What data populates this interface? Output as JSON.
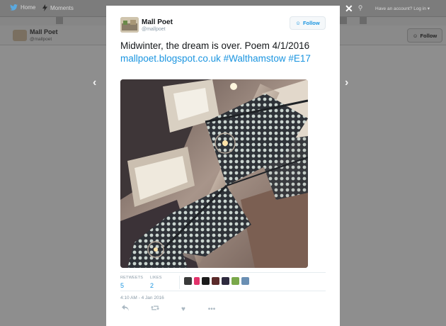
{
  "background": {
    "nav": {
      "home": "Home",
      "moments": "Moments",
      "account": "Have an account? Log in"
    },
    "profile": {
      "name": "Mall Poet",
      "handle": "@mallpoet",
      "follow_label": "Follow"
    }
  },
  "modal": {
    "author": {
      "name": "Mall Poet",
      "handle": "@mallpoet"
    },
    "follow_label": "Follow",
    "tweet": {
      "text": "Midwinter, the dream is over. Poem 4/1/2016",
      "link": "mallpoet.blogspot.co.uk",
      "hashtags": [
        "#Walthamstow",
        "#E17"
      ]
    },
    "stats": {
      "retweets_label": "RETWEETS",
      "retweets": "5",
      "likes_label": "LIKES",
      "likes": "2"
    },
    "timestamp": "4:10 AM - 4 Jan 2016"
  },
  "colors": {
    "accent": "#1b95e0",
    "muted": "#8899a6"
  },
  "icons": [
    "twitter-bird-icon",
    "lightning-icon",
    "search-icon",
    "close-icon",
    "chevron-left-icon",
    "chevron-right-icon",
    "add-user-icon",
    "reply-icon",
    "retweet-icon",
    "like-icon",
    "more-icon"
  ]
}
